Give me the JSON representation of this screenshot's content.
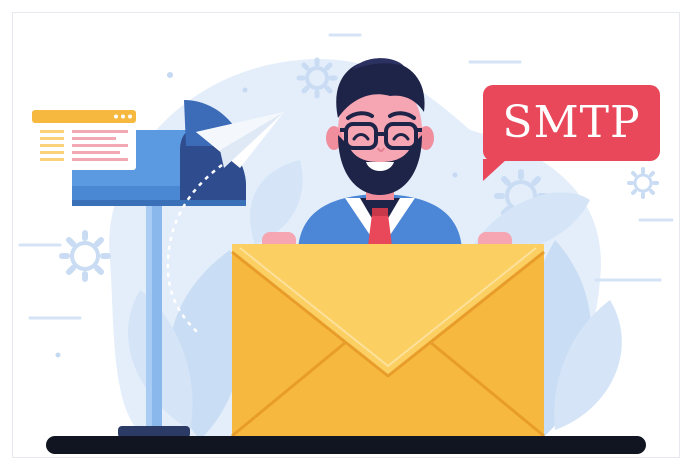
{
  "illustration": {
    "speech_bubble": {
      "text": "SMTP",
      "color": "#e9485a"
    },
    "icons": [
      "gear-icon",
      "paper-plane-icon",
      "mailbox-icon",
      "envelope-icon",
      "browser-window-icon"
    ],
    "colors": {
      "background_blob": "#e3eefa",
      "leaf": "#c9ddf4",
      "mailbox": "#5b9ae0",
      "envelope": "#f7b840",
      "envelope_flap": "#fbcf62",
      "desk": "#111521",
      "hair": "#1e2348",
      "skin": "#f5a6b2",
      "jacket": "#4c86d6",
      "tie": "#e9485a"
    }
  }
}
